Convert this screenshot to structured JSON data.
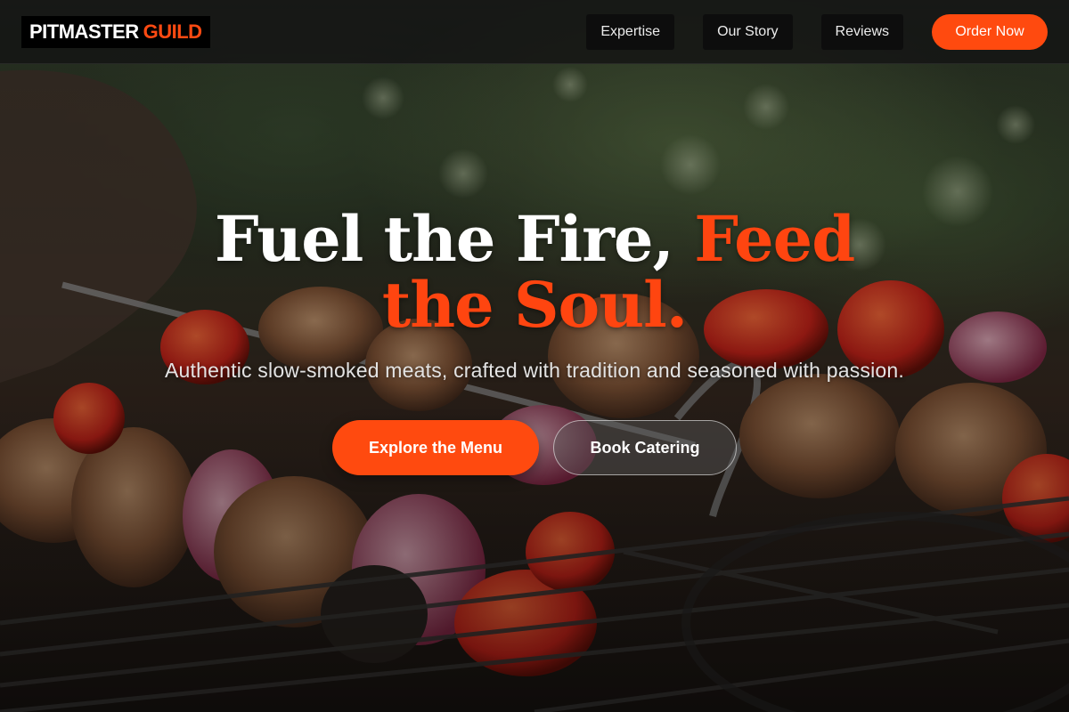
{
  "brand": {
    "name_part1": "PITMASTER",
    "name_part2": "GUILD"
  },
  "nav": {
    "links": [
      {
        "label": "Expertise"
      },
      {
        "label": "Our Story"
      },
      {
        "label": "Reviews"
      }
    ],
    "order_label": "Order Now"
  },
  "hero": {
    "headline_part1": "Fuel the Fire,",
    "headline_part2": "Feed the Soul.",
    "subtitle": "Authentic slow-smoked meats, crafted with tradition and seasoned with passion.",
    "primary_cta": "Explore the Menu",
    "secondary_cta": "Book Catering",
    "background_image": "grilled-skewers-photo"
  },
  "colors": {
    "accent": "#ff4a0f",
    "navbar_bg": "#141414",
    "nav_button_bg": "#0d0d0d",
    "text": "#ffffff"
  }
}
